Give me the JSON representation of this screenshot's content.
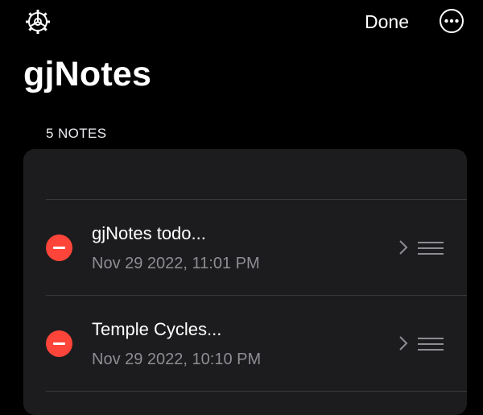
{
  "nav": {
    "settings_icon": "gear-icon",
    "done_label": "Done",
    "more_icon": "ellipsis-circle-icon"
  },
  "title": "gjNotes",
  "section_header": "5 NOTES",
  "notes": [
    {
      "title": "gjNotes todo...",
      "date": "Nov 29 2022, 11:01 PM"
    },
    {
      "title": "Temple Cycles...",
      "date": "Nov 29 2022, 10:10 PM"
    }
  ],
  "colors": {
    "background": "#000000",
    "card": "#1c1c1e",
    "delete": "#ff453a",
    "secondary_text": "#8d8d93"
  }
}
